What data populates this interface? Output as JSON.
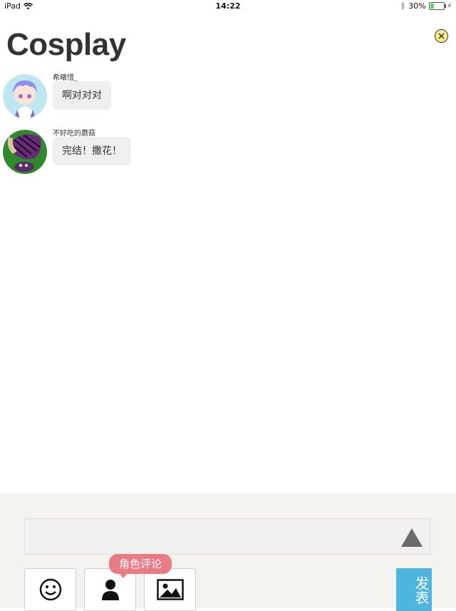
{
  "status_bar": {
    "device": "iPad",
    "time": "14:22",
    "battery": "30%",
    "battery_level": 0.3
  },
  "page": {
    "title": "Cosplay"
  },
  "messages": [
    {
      "username": "希曦惜_",
      "text": "啊对对对",
      "avatar": "boy-anime-avatar"
    },
    {
      "username": "不好吃的蘑菇",
      "text": "完结！撒花！",
      "avatar": "mushroom-avatar"
    }
  ],
  "composer": {
    "input_value": "",
    "tooltip": "角色评论",
    "send_label": "发表",
    "tools": [
      "emoji-icon",
      "person-icon",
      "image-icon"
    ]
  },
  "colors": {
    "accent_send": "#4db6dd",
    "tooltip_bg": "#e97b85",
    "close_bg": "#f6ec8a",
    "panel_bg": "#f4f3ef"
  }
}
